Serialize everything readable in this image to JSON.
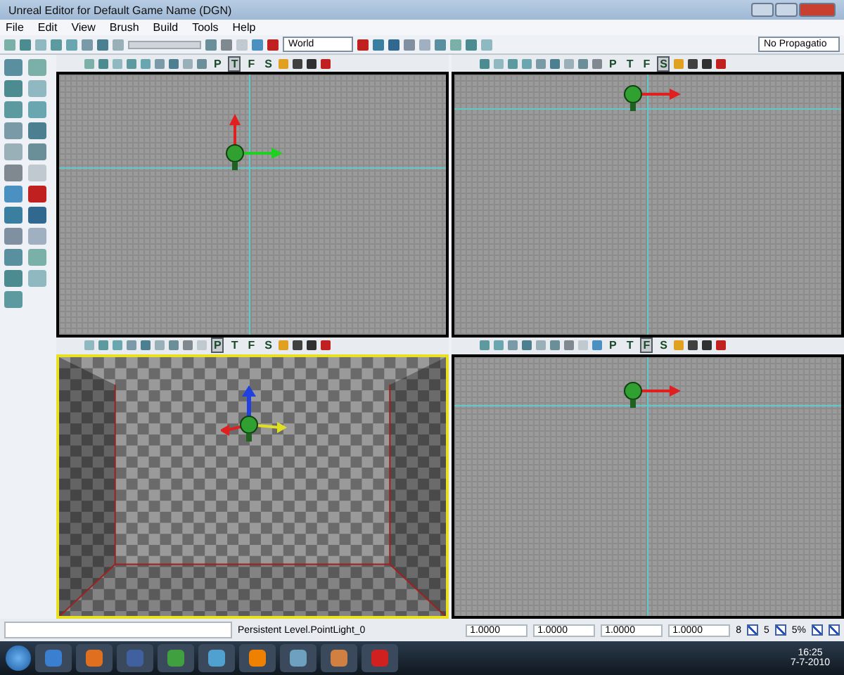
{
  "window": {
    "title": "Unreal Editor for Default Game Name (DGN)"
  },
  "menu": [
    "File",
    "Edit",
    "View",
    "Brush",
    "Build",
    "Tools",
    "Help"
  ],
  "toolbar": {
    "coordinate_dropdown": "World",
    "propagation_dropdown": "No Propagatio"
  },
  "viewports": [
    {
      "kind": "top",
      "view_buttons": [
        {
          "label": "P",
          "selected": false
        },
        {
          "label": "T",
          "selected": true
        },
        {
          "label": "F",
          "selected": false
        },
        {
          "label": "S",
          "selected": false
        }
      ],
      "active": false
    },
    {
      "kind": "side",
      "view_buttons": [
        {
          "label": "P",
          "selected": false
        },
        {
          "label": "T",
          "selected": false
        },
        {
          "label": "F",
          "selected": false
        },
        {
          "label": "S",
          "selected": true
        }
      ],
      "active": false
    },
    {
      "kind": "perspective",
      "view_buttons": [
        {
          "label": "P",
          "selected": true
        },
        {
          "label": "T",
          "selected": false
        },
        {
          "label": "F",
          "selected": false
        },
        {
          "label": "S",
          "selected": false
        }
      ],
      "active": true
    },
    {
      "kind": "front",
      "view_buttons": [
        {
          "label": "P",
          "selected": false
        },
        {
          "label": "T",
          "selected": false
        },
        {
          "label": "F",
          "selected": true
        },
        {
          "label": "S",
          "selected": false
        }
      ],
      "active": false
    }
  ],
  "status_bar": {
    "selection": "Persistent Level.PointLight_0",
    "scale_fields": [
      "1.0000",
      "1.0000",
      "1.0000",
      "1.0000"
    ],
    "grid_size": "8",
    "rotation_snap": "5",
    "scale_snap": "5%",
    "toggles": [
      {
        "checked": true
      },
      {
        "checked": true
      },
      {
        "checked": true
      },
      {
        "checked": true
      }
    ]
  },
  "taskbar": {
    "time": "16:25",
    "date": "7-7-2010"
  }
}
